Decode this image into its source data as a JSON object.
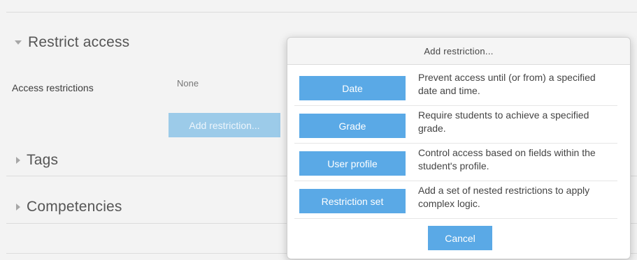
{
  "sections": {
    "restrict_access": "Restrict access",
    "tags": "Tags",
    "competencies": "Competencies"
  },
  "access_restrictions": {
    "label": "Access restrictions",
    "value": "None",
    "add_button": "Add restriction..."
  },
  "dialog": {
    "title": "Add restriction...",
    "options": [
      {
        "button": "Date",
        "description": "Prevent access until (or from) a specified date and time."
      },
      {
        "button": "Grade",
        "description": "Require students to achieve a specified grade."
      },
      {
        "button": "User profile",
        "description": "Control access based on fields within the student's profile."
      },
      {
        "button": "Restriction set",
        "description": "Add a set of nested restrictions to apply complex logic."
      }
    ],
    "cancel": "Cancel"
  },
  "colors": {
    "button_primary": "#5aa9e6",
    "button_disabled": "#9ccbe9"
  }
}
